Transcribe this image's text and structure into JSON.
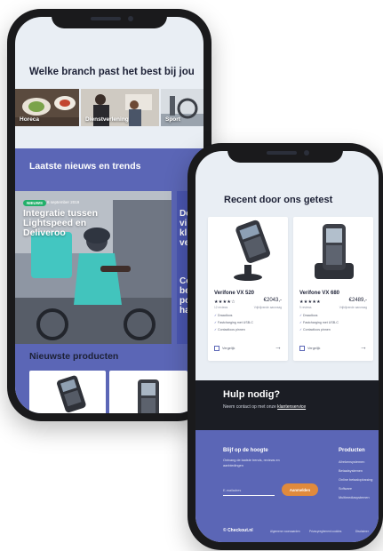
{
  "phone_a": {
    "branch_heading": "Welke branch past het best bij jou",
    "branches": [
      {
        "label": "Horeca"
      },
      {
        "label": "Dienstverlening"
      },
      {
        "label": "Sport"
      }
    ],
    "news": {
      "title": "Laatste nieuws en trends",
      "badge": "NIEUWS",
      "date": "6 september 2019",
      "headline": "Integratie tussen Lightspeed en Deliveroo",
      "side_fragments": [
        "De",
        "vi",
        "kl",
        "ve",
        "Co",
        "be",
        "po",
        "ha"
      ]
    },
    "products_title": "Nieuwste producten"
  },
  "phone_b": {
    "heading": "Recent door ons getest",
    "products": [
      {
        "name": "Verifone VX 520",
        "stars": "★★★★☆",
        "reviews": "12 reviews",
        "price": "€2043,-",
        "vat": "Vrijblijvende aanvraag",
        "features": [
          "Draadloos",
          "Fastcharging met USB-C",
          "Contactloos pinnen"
        ],
        "compare": "Vergelijk"
      },
      {
        "name": "Verifone VX 680",
        "stars": "★★★★★",
        "reviews": "9 reviews",
        "price": "€2489,-",
        "vat": "Vrijblijvende aanvraag",
        "features": [
          "Draadloos",
          "Fastcharging met USB-C",
          "Contactloos pinnen"
        ],
        "compare": "Vergelijk"
      }
    ],
    "help": {
      "title": "Hulp nodig?",
      "subtitle": "Neem contact op met onze",
      "link": "klantenservice"
    },
    "footer": {
      "newsletter_title": "Blijf op de hoogte",
      "newsletter_text": "Ontvang de laatste trends, reviews en aanbiedingen",
      "email_placeholder": "E-mailadres",
      "subscribe": "Aanmelden",
      "products_title": "Producten",
      "products_links": [
        "Afrekensystemen",
        "Betaalsystemen",
        "Online betaaloplossing",
        "Software",
        "Multimediasystemen"
      ],
      "logo": "© Checkout.nl",
      "bottom_links": [
        "Algemene voorwaarden",
        "Privacyreglement cookies",
        "Disclaimer"
      ]
    }
  }
}
